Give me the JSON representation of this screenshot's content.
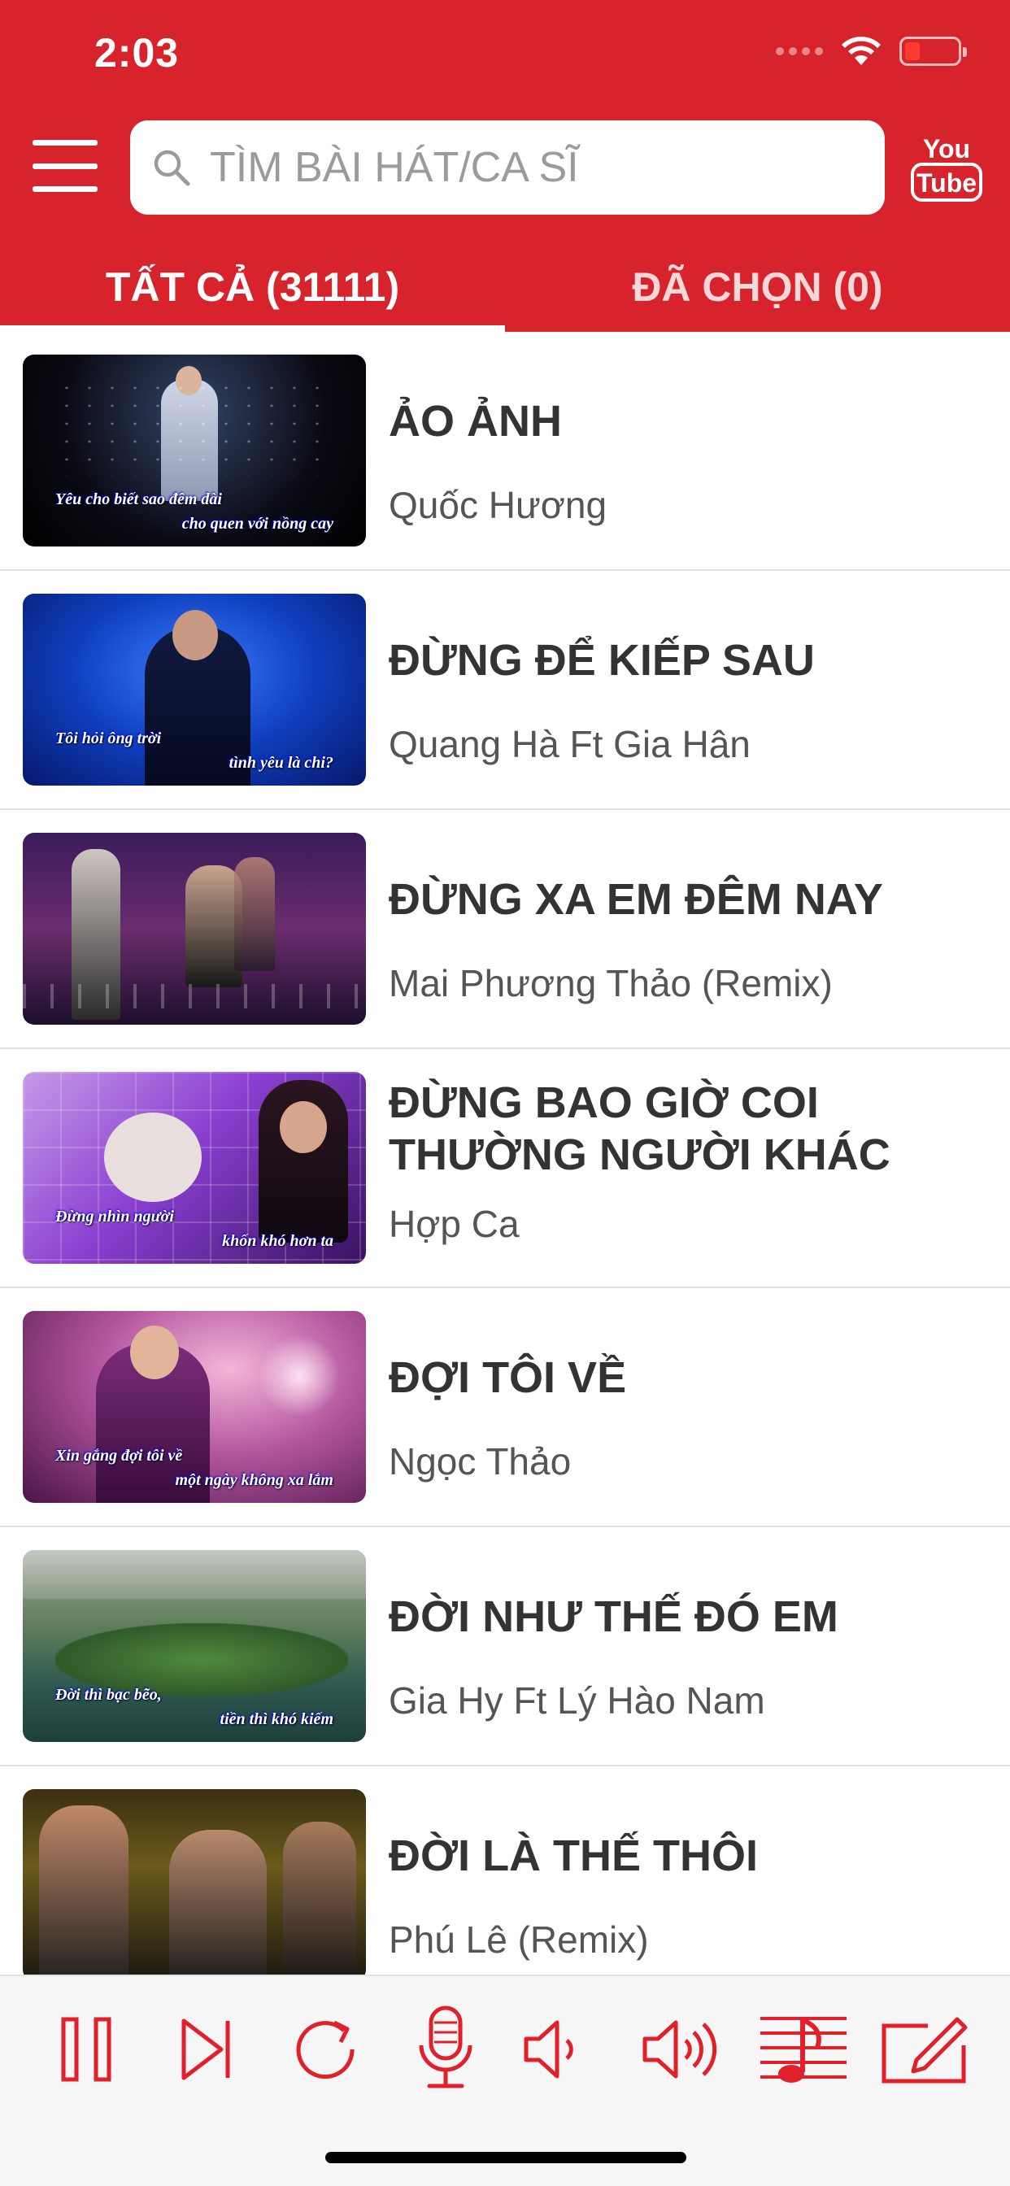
{
  "status_bar": {
    "time": "2:03"
  },
  "header": {
    "search": {
      "placeholder": "TÌM BÀI HÁT/CA SĨ",
      "value": ""
    },
    "tabs": [
      {
        "label": "TẤT CẢ (31111)",
        "active": true
      },
      {
        "label": "ĐÃ CHỌN (0)",
        "active": false
      }
    ],
    "youtube_text": {
      "line1": "You",
      "line2": "Tube"
    },
    "brand_color": "#d7232b"
  },
  "songs": [
    {
      "title": "ẢO ẢNH",
      "artist": "Quốc Hương",
      "caption1": "Yêu cho biết sao đêm dài",
      "caption2": "cho quen với nồng cay"
    },
    {
      "title": "ĐỪNG ĐỂ KIẾP SAU",
      "artist": "Quang Hà Ft Gia Hân",
      "caption1": "Tôi hỏi ông trời",
      "caption2": "tình yêu là chi?"
    },
    {
      "title": "ĐỪNG XA EM ĐÊM NAY",
      "artist": "Mai Phương Thảo (Remix)",
      "caption1": "",
      "caption2": ""
    },
    {
      "title": "ĐỪNG BAO GIỜ COI THƯỜNG NGƯỜI KHÁC",
      "artist": "Hợp Ca",
      "caption1": "Đừng nhìn người",
      "caption2": "khốn khó hơn ta"
    },
    {
      "title": "ĐỢI TÔI VỀ",
      "artist": "Ngọc Thảo",
      "caption1": "Xin gắng đợi tôi về",
      "caption2": "một ngày không xa lắm"
    },
    {
      "title": "ĐỜI NHƯ THẾ ĐÓ EM",
      "artist": "Gia Hy Ft Lý Hào Nam",
      "caption1": "Đời thì bạc bẽo,",
      "caption2": "tiền thì khó kiếm"
    },
    {
      "title": "ĐỜI LÀ THẾ THÔI",
      "artist": "Phú Lê (Remix)",
      "caption1": "",
      "caption2": ""
    }
  ],
  "toolbar": {
    "icons": [
      "pause-icon",
      "skip-next-icon",
      "replay-icon",
      "microphone-icon",
      "volume-down-icon",
      "volume-up-icon",
      "music-score-icon",
      "edit-icon"
    ],
    "accent_color": "#e0202a"
  }
}
